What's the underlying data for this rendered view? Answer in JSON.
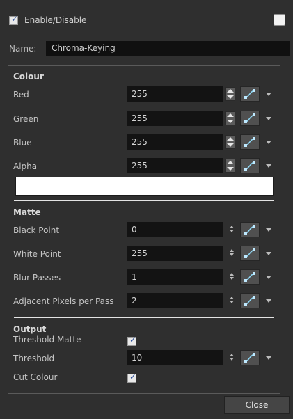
{
  "header": {
    "enable_label": "Enable/Disable",
    "name_label": "Name:",
    "name_value": "Chroma-Keying"
  },
  "colour": {
    "title": "Colour",
    "rows": [
      {
        "label": "Red",
        "value": "255"
      },
      {
        "label": "Green",
        "value": "255"
      },
      {
        "label": "Blue",
        "value": "255"
      },
      {
        "label": "Alpha",
        "value": "255"
      }
    ],
    "swatch_color": "#ffffff"
  },
  "matte": {
    "title": "Matte",
    "rows": [
      {
        "label": "Black Point",
        "value": "0"
      },
      {
        "label": "White Point",
        "value": "255"
      },
      {
        "label": "Blur Passes",
        "value": "1"
      },
      {
        "label": "Adjacent Pixels per Pass",
        "value": "2"
      }
    ]
  },
  "output": {
    "title": "Output",
    "threshold_matte_label": "Threshold Matte",
    "threshold_label": "Threshold",
    "threshold_value": "10",
    "cut_colour_label": "Cut Colour"
  },
  "footer": {
    "close_label": "Close"
  },
  "icons": {
    "curve": "function-curve-icon",
    "spin": "spinner-arrows-icon",
    "dropdown": "dropdown-arrow-icon",
    "check": "checkmark-icon"
  }
}
